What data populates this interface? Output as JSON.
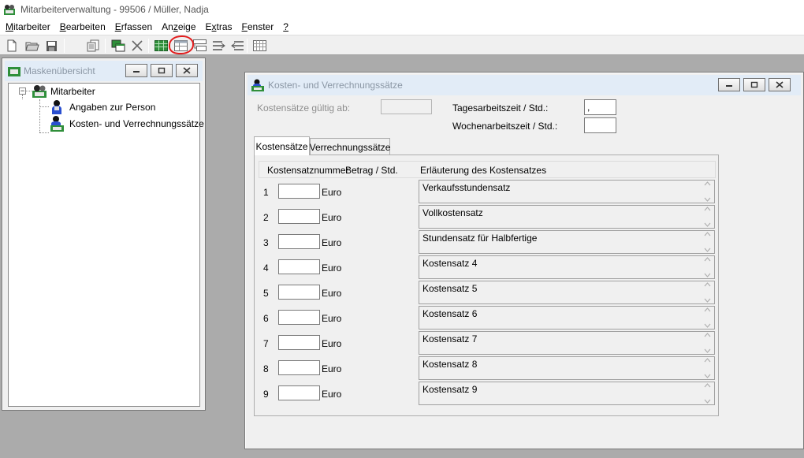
{
  "app": {
    "title": "Mitarbeiterverwaltung - 99506 / Müller, Nadja"
  },
  "menu": [
    {
      "label": "Mitarbeiter",
      "hotkey": "M",
      "rest": "itarbeiter"
    },
    {
      "label": "Bearbeiten",
      "hotkey": "B",
      "rest": "earbeiten"
    },
    {
      "label": "Erfassen",
      "hotkey": "E",
      "rest": "rfassen"
    },
    {
      "label": "Anzeige",
      "hotkey": "z",
      "pre": "An",
      "rest": "eige"
    },
    {
      "label": "Extras",
      "hotkey": "x",
      "pre": "E",
      "rest": "tras"
    },
    {
      "label": "Fenster",
      "hotkey": "F",
      "rest": "enster"
    },
    {
      "label": "?",
      "hotkey": "?",
      "rest": ""
    }
  ],
  "toolbar": {
    "icons": [
      "new-document-icon",
      "open-folder-icon",
      "save-disk-icon",
      "copy-record-icon",
      "window-cascade-icon",
      "delete-x-icon",
      "table-green-icon",
      "table-view-icon",
      "split-view-icon",
      "arrow-right-icon",
      "arrow-left-icon",
      "grid-view-icon"
    ]
  },
  "overview": {
    "title": "Maskenübersicht",
    "tree": {
      "root": "Mitarbeiter",
      "children": [
        "Angaben zur Person",
        "Kosten- und Verrechnungssätze"
      ]
    }
  },
  "costs_window": {
    "title": "Kosten- und Verrechnungssätze",
    "valid_from_label": "Kostensätze gültig ab:",
    "valid_from_value": "",
    "daily_hours_label": "Tagesarbeitszeit / Std.:",
    "daily_hours_value": ",",
    "weekly_hours_label": "Wochenarbeitszeit / Std.:",
    "weekly_hours_value": "",
    "tabs": [
      "Kostensätze",
      "Verrechnungssätze"
    ],
    "table_headers": [
      "Kostensatznummer",
      "Betrag / Std.",
      "Erläuterung des Kostensatzes"
    ],
    "rows": [
      {
        "num": "1",
        "unit": "Euro",
        "amount": "",
        "desc": "Verkaufsstundensatz"
      },
      {
        "num": "2",
        "unit": "Euro",
        "amount": "",
        "desc": "Vollkostensatz"
      },
      {
        "num": "3",
        "unit": "Euro",
        "amount": "",
        "desc": "Stundensatz für Halbfertige"
      },
      {
        "num": "4",
        "unit": "Euro",
        "amount": "",
        "desc": "Kostensatz 4"
      },
      {
        "num": "5",
        "unit": "Euro",
        "amount": "",
        "desc": "Kostensatz 5"
      },
      {
        "num": "6",
        "unit": "Euro",
        "amount": "",
        "desc": "Kostensatz 6"
      },
      {
        "num": "7",
        "unit": "Euro",
        "amount": "",
        "desc": "Kostensatz 7"
      },
      {
        "num": "8",
        "unit": "Euro",
        "amount": "",
        "desc": "Kostensatz 8"
      },
      {
        "num": "9",
        "unit": "Euro",
        "amount": "",
        "desc": "Kostensatz 9"
      }
    ]
  }
}
